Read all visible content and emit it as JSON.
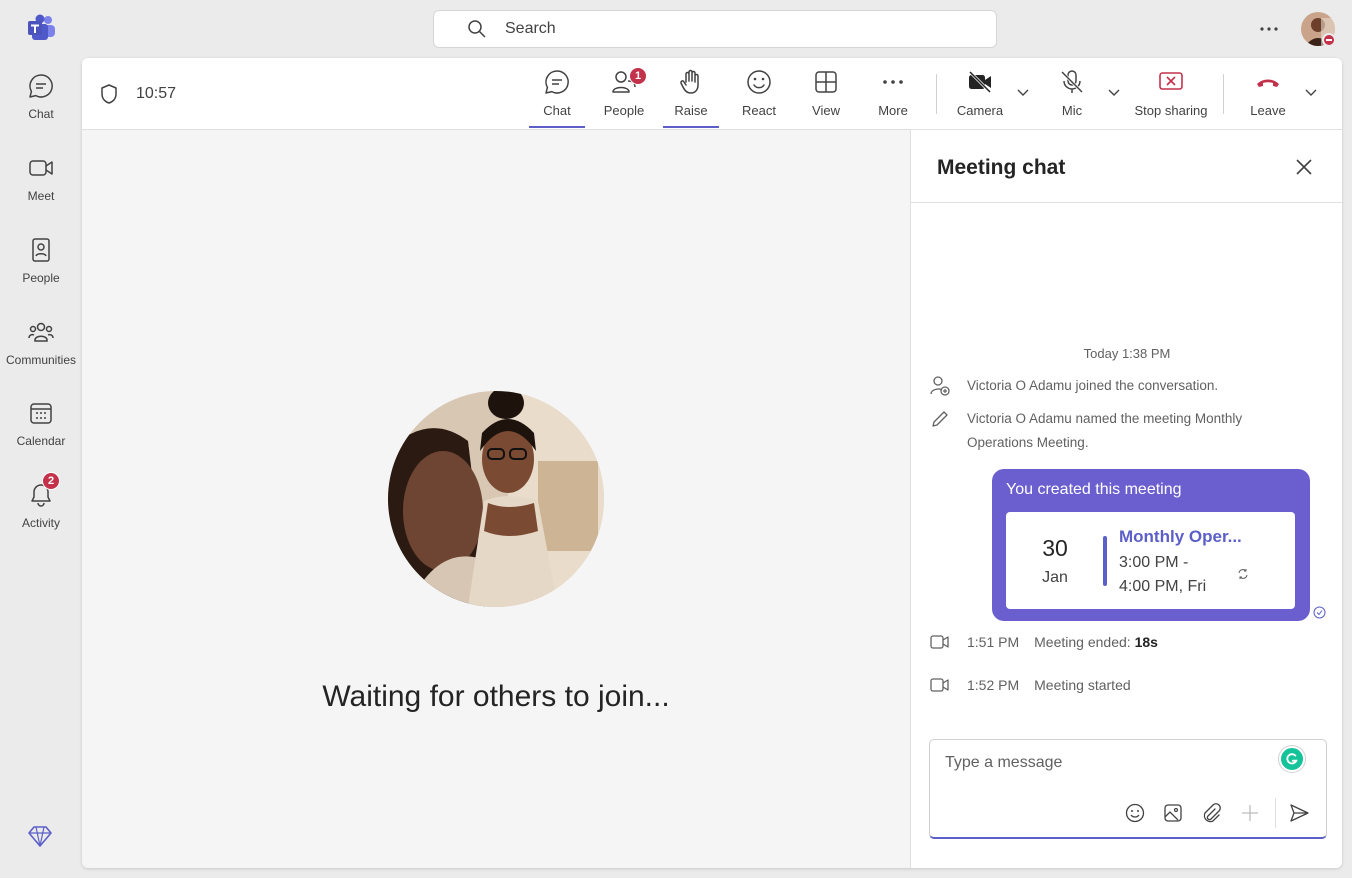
{
  "search": {
    "placeholder": "Search"
  },
  "rail": {
    "items": [
      {
        "label": "Chat"
      },
      {
        "label": "Meet"
      },
      {
        "label": "People"
      },
      {
        "label": "Communities"
      },
      {
        "label": "Calendar"
      },
      {
        "label": "Activity",
        "badge": "2"
      }
    ]
  },
  "meeting": {
    "timer": "10:57",
    "toolbar": {
      "chat": "Chat",
      "people": "People",
      "people_badge": "1",
      "raise": "Raise",
      "react": "React",
      "view": "View",
      "more": "More",
      "camera": "Camera",
      "mic": "Mic",
      "stop_sharing": "Stop sharing",
      "leave": "Leave"
    },
    "stage": {
      "waiting_text": "Waiting for others to join..."
    }
  },
  "chat": {
    "title": "Meeting chat",
    "date_separator": "Today 1:38 PM",
    "system_messages": [
      "Victoria O Adamu joined the conversation.",
      "Victoria O Adamu named the meeting Monthly Operations Meeting."
    ],
    "created_bubble": {
      "title": "You created this meeting",
      "day": "30",
      "month": "Jan",
      "meeting_title": "Monthly Oper...",
      "time_line1": "3:00 PM -",
      "time_line2": "4:00 PM, Fri"
    },
    "meeting_events": [
      {
        "time": "1:51 PM",
        "text": "Meeting ended:",
        "duration": "18s"
      },
      {
        "time": "1:52 PM",
        "text": "Meeting started"
      }
    ],
    "composer": {
      "placeholder": "Type a message"
    }
  },
  "colors": {
    "accent": "#5b5fc7",
    "bubble": "#6b5fd0",
    "badge": "#c4314b",
    "leave": "#c4314b"
  }
}
